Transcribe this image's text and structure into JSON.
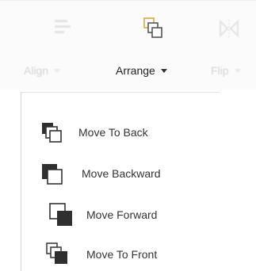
{
  "toolbar": {
    "align": {
      "label": "Align",
      "icon": "align-icon"
    },
    "arrange": {
      "label": "Arrange",
      "icon": "arrange-icon"
    },
    "flip": {
      "label": "Flip",
      "icon": "flip-icon"
    }
  },
  "menu": {
    "items": [
      {
        "label": "Move To Back",
        "icon": "move-to-back-icon"
      },
      {
        "label": "Move Backward",
        "icon": "move-backward-icon"
      },
      {
        "label": "Move Forward",
        "icon": "move-forward-icon"
      },
      {
        "label": "Move To Front",
        "icon": "move-to-front-icon"
      }
    ]
  },
  "colors": {
    "icon_dark": "#333333",
    "icon_outline": "#444444",
    "toolbar_bg": "#fbfbfb"
  }
}
